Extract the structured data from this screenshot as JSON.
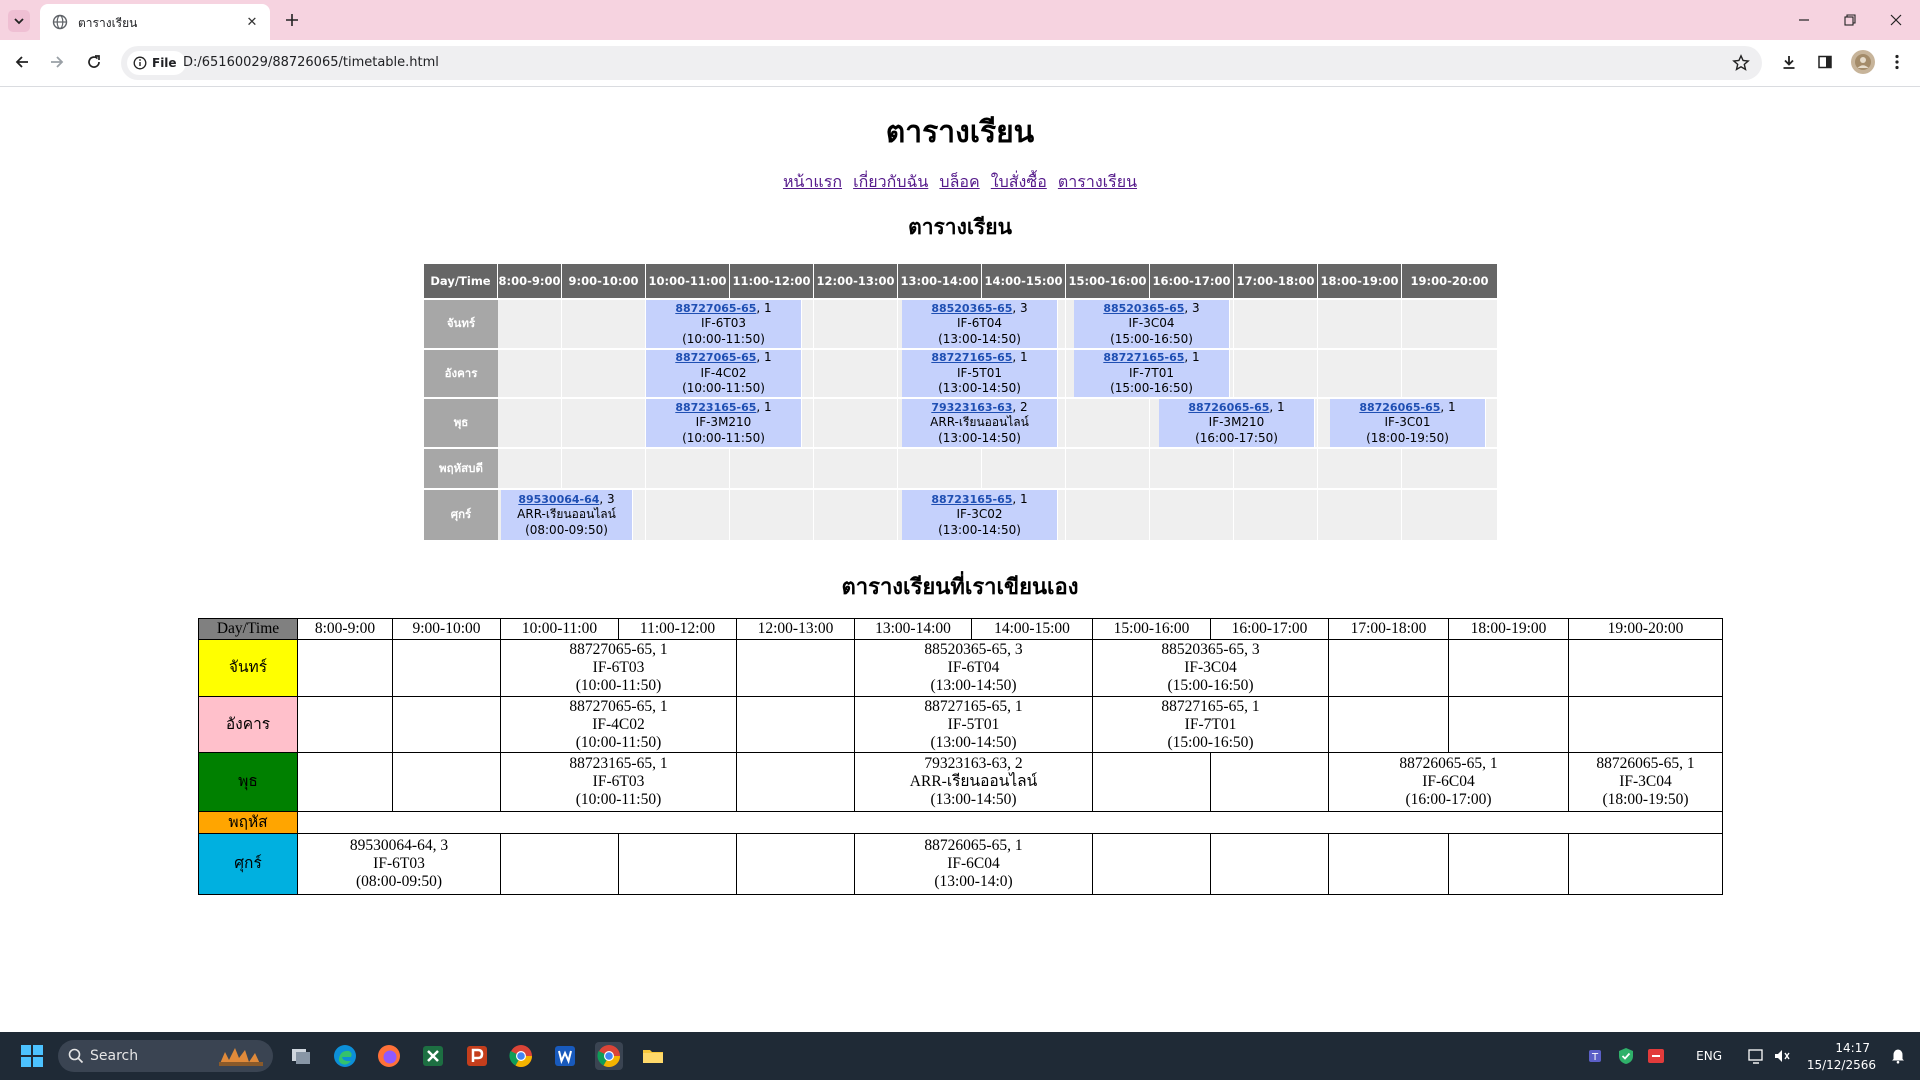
{
  "browser": {
    "tab_title": "ตารางเรียน",
    "url": "D:/65160029/88726065/timetable.html",
    "site_info_label": "File"
  },
  "page": {
    "title": "ตารางเรียน",
    "nav": [
      "หน้าแรก",
      "เกี่ยวกับฉัน",
      "บล็อค",
      "ใบสั่งซื้อ",
      "ตารางเรียน"
    ],
    "section1_title": "ตารางเรียน",
    "section2_title": "ตารางเรียนที่เราเขียนเอง"
  },
  "timetable1": {
    "corner": "Day/Time",
    "times": [
      "8:00-9:00",
      "9:00-10:00",
      "10:00-11:00",
      "11:00-12:00",
      "12:00-13:00",
      "13:00-14:00",
      "14:00-15:00",
      "15:00-16:00",
      "16:00-17:00",
      "17:00-18:00",
      "18:00-19:00",
      "19:00-20:00"
    ],
    "days": [
      "จันทร์",
      "อังคาร",
      "พุธ",
      "พฤหัสบดี",
      "ศุกร์"
    ],
    "blocks": [
      {
        "code": "88727065-65",
        "group": ", 1",
        "room": "IF-6T03",
        "time": "(10:00-11:50)"
      },
      {
        "code": "88520365-65",
        "group": ", 3",
        "room": "IF-6T04",
        "time": "(13:00-14:50)"
      },
      {
        "code": "88520365-65",
        "group": ", 3",
        "room": "IF-3C04",
        "time": "(15:00-16:50)"
      },
      {
        "code": "88727065-65",
        "group": ", 1",
        "room": "IF-4C02",
        "time": "(10:00-11:50)"
      },
      {
        "code": "88727165-65",
        "group": ", 1",
        "room": "IF-5T01",
        "time": "(13:00-14:50)"
      },
      {
        "code": "88727165-65",
        "group": ", 1",
        "room": "IF-7T01",
        "time": "(15:00-16:50)"
      },
      {
        "code": "88723165-65",
        "group": ", 1",
        "room": "IF-3M210",
        "time": "(10:00-11:50)"
      },
      {
        "code": "79323163-63",
        "group": ", 2",
        "room": "ARR-เรียนออนไลน์",
        "time": "(13:00-14:50)"
      },
      {
        "code": "88726065-65",
        "group": ", 1",
        "room": "IF-3M210",
        "time": "(16:00-17:50)"
      },
      {
        "code": "88726065-65",
        "group": ", 1",
        "room": "IF-3C01",
        "time": "(18:00-19:50)"
      },
      {
        "code": "89530064-64",
        "group": ", 3",
        "room": "ARR-เรียนออนไลน์",
        "time": "(08:00-09:50)"
      },
      {
        "code": "88723165-65",
        "group": ", 1",
        "room": "IF-3C02",
        "time": "(13:00-14:50)"
      }
    ]
  },
  "timetable2": {
    "corner": "Day/Time",
    "times": [
      "8:00-9:00",
      "9:00-10:00",
      "10:00-11:00",
      "11:00-12:00",
      "12:00-13:00",
      "13:00-14:00",
      "14:00-15:00",
      "15:00-16:00",
      "16:00-17:00",
      "17:00-18:00",
      "18:00-19:00",
      "19:00-20:00"
    ],
    "days": [
      {
        "name": "จันทร์",
        "color": "#ffff00"
      },
      {
        "name": "อังคาร",
        "color": "#ffc0cb"
      },
      {
        "name": "พุธ",
        "color": "#008000"
      },
      {
        "name": "พฤหัส",
        "color": "#ffa500"
      },
      {
        "name": "ศุกร์",
        "color": "#00b0e0"
      }
    ],
    "blocks": [
      [
        "88727065-65, 1",
        "IF-6T03",
        "(10:00-11:50)"
      ],
      [
        "88520365-65, 3",
        "IF-6T04",
        "(13:00-14:50)"
      ],
      [
        "88520365-65, 3",
        "IF-3C04",
        "(15:00-16:50)"
      ],
      [
        "88727065-65, 1",
        "IF-4C02",
        "(10:00-11:50)"
      ],
      [
        "88727165-65, 1",
        "IF-5T01",
        "(13:00-14:50)"
      ],
      [
        "88727165-65, 1",
        "IF-7T01",
        "(15:00-16:50)"
      ],
      [
        "88723165-65, 1",
        "IF-6T03",
        "(10:00-11:50)"
      ],
      [
        "79323163-63, 2",
        "ARR-เรียนออนไลน์",
        "(13:00-14:50)"
      ],
      [
        "88726065-65, 1",
        "IF-6C04",
        "(16:00-17:00)"
      ],
      [
        "88726065-65, 1",
        "IF-3C04",
        "(18:00-19:50)"
      ],
      [
        "89530064-64, 3",
        "IF-6T03",
        "(08:00-09:50)"
      ],
      [
        "88726065-65, 1",
        "IF-6C04",
        "(13:00-14:0)"
      ]
    ]
  },
  "taskbar": {
    "search_label": "Search",
    "lang": "ENG",
    "time": "14:17",
    "date": "15/12/2566"
  }
}
